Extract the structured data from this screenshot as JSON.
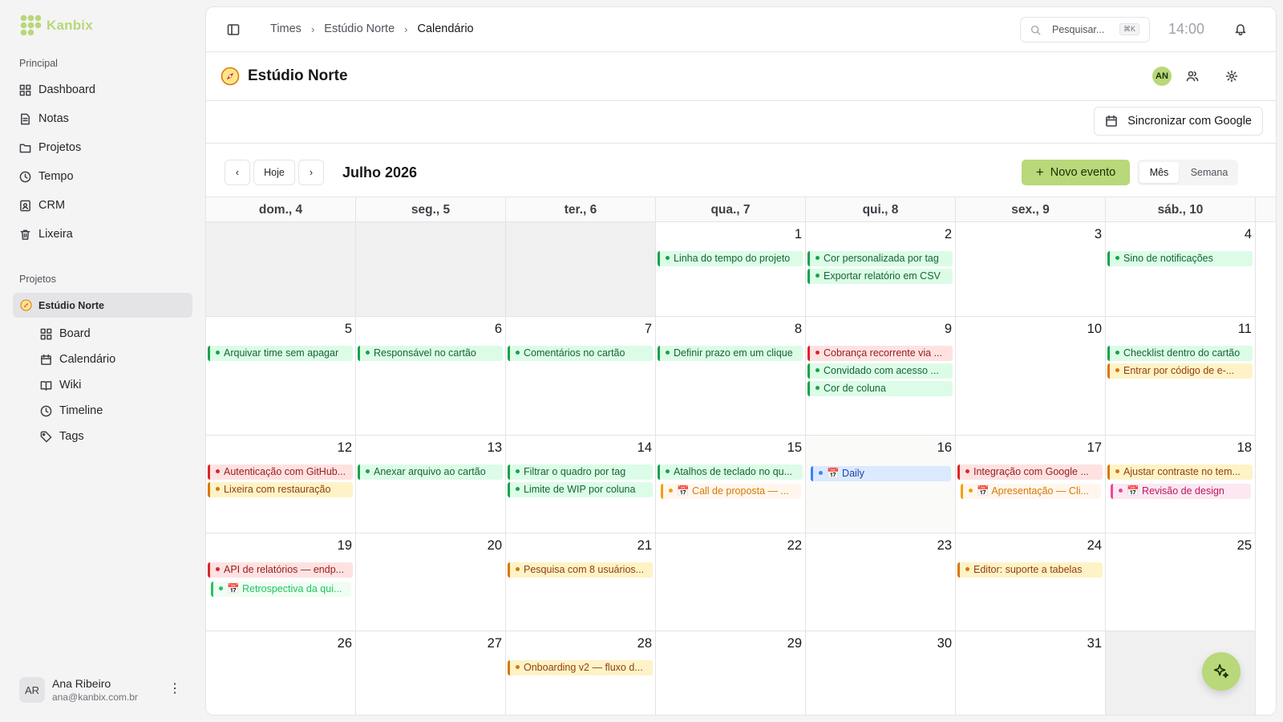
{
  "app": {
    "name": "Kanbix"
  },
  "sidebar": {
    "principal_label": "Principal",
    "items": [
      {
        "label": "Dashboard",
        "icon": "dashboard-icon"
      },
      {
        "label": "Notas",
        "icon": "notes-icon"
      },
      {
        "label": "Projetos",
        "icon": "folder-icon"
      },
      {
        "label": "Tempo",
        "icon": "clock-icon"
      },
      {
        "label": "CRM",
        "icon": "contact-icon"
      },
      {
        "label": "Lixeira",
        "icon": "trash-icon"
      }
    ],
    "projects_label": "Projetos",
    "project": {
      "name": "Estúdio Norte",
      "icon": "compass-icon"
    },
    "project_items": [
      {
        "label": "Board",
        "icon": "board-icon"
      },
      {
        "label": "Calendário",
        "icon": "calendar-icon"
      },
      {
        "label": "Wiki",
        "icon": "book-icon"
      },
      {
        "label": "Timeline",
        "icon": "clock-icon"
      },
      {
        "label": "Tags",
        "icon": "tag-icon"
      }
    ],
    "user": {
      "initials": "AR",
      "name": "Ana Ribeiro",
      "email": "ana@kanbix.com.br"
    }
  },
  "topbar": {
    "breadcrumb": [
      "Times",
      "Estúdio Norte",
      "Calendário"
    ],
    "search_placeholder": "Pesquisar...",
    "search_shortcut": "⌘K",
    "time": "14:00"
  },
  "project_header": {
    "title": "Estúdio Norte",
    "member_initials": "AN"
  },
  "sync_button": "Sincronizar com Google",
  "calendar": {
    "today_label": "Hoje",
    "month_label": "Julho 2026",
    "new_event_label": "Novo evento",
    "view_month": "Mês",
    "view_week": "Semana",
    "weekdays": [
      "dom., 4",
      "seg., 5",
      "ter., 6",
      "qua., 7",
      "qui., 8",
      "sex., 9",
      "sáb., 10"
    ],
    "weeks": [
      [
        {
          "day": "",
          "out": true,
          "events": []
        },
        {
          "day": "",
          "out": true,
          "events": []
        },
        {
          "day": "",
          "out": true,
          "events": []
        },
        {
          "day": "1",
          "events": [
            {
              "title": "Linha do tempo do projeto",
              "color": "green"
            }
          ]
        },
        {
          "day": "2",
          "events": [
            {
              "title": "Cor personalizada por tag",
              "color": "green"
            },
            {
              "title": "Exportar relatório em CSV",
              "color": "green"
            }
          ]
        },
        {
          "day": "3",
          "events": []
        },
        {
          "day": "4",
          "events": [
            {
              "title": "Sino de notificações",
              "color": "green"
            }
          ]
        }
      ],
      [
        {
          "day": "5",
          "events": [
            {
              "title": "Arquivar time sem apagar",
              "color": "green"
            }
          ]
        },
        {
          "day": "6",
          "events": [
            {
              "title": "Responsável no cartão",
              "color": "green"
            }
          ]
        },
        {
          "day": "7",
          "events": [
            {
              "title": "Comentários no cartão",
              "color": "green"
            }
          ]
        },
        {
          "day": "8",
          "events": [
            {
              "title": "Definir prazo em um clique",
              "color": "green"
            }
          ]
        },
        {
          "day": "9",
          "events": [
            {
              "title": "Cobrança recorrente via ...",
              "color": "red"
            },
            {
              "title": "Convidado com acesso ...",
              "color": "green"
            },
            {
              "title": "Cor de coluna",
              "color": "green"
            }
          ]
        },
        {
          "day": "10",
          "events": []
        },
        {
          "day": "11",
          "events": [
            {
              "title": "Checklist dentro do cartão",
              "color": "green"
            },
            {
              "title": "Entrar por código de e-...",
              "color": "orange"
            }
          ]
        }
      ],
      [
        {
          "day": "12",
          "events": [
            {
              "title": "Autenticação com GitHub...",
              "color": "red"
            },
            {
              "title": "Lixeira com restauração",
              "color": "orange"
            }
          ]
        },
        {
          "day": "13",
          "events": [
            {
              "title": "Anexar arquivo ao cartão",
              "color": "green"
            }
          ]
        },
        {
          "day": "14",
          "events": [
            {
              "title": "Filtrar o quadro por tag",
              "color": "green"
            },
            {
              "title": "Limite de WIP por coluna",
              "color": "green"
            }
          ]
        },
        {
          "day": "15",
          "events": [
            {
              "title": "Atalhos de teclado no qu...",
              "color": "green"
            },
            {
              "title": "📅 Call de proposta — ...",
              "color": "mtg-orange",
              "meeting": true
            }
          ]
        },
        {
          "day": "16",
          "today": true,
          "events": [
            {
              "title": "📅 Daily",
              "color": "mtg-blue",
              "meeting": true
            }
          ]
        },
        {
          "day": "17",
          "events": [
            {
              "title": "Integração com Google ...",
              "color": "red"
            },
            {
              "title": "📅 Apresentação — Cli...",
              "color": "mtg-orange",
              "meeting": true
            }
          ]
        },
        {
          "day": "18",
          "events": [
            {
              "title": "Ajustar contraste no tem...",
              "color": "orange"
            },
            {
              "title": "📅 Revisão de design",
              "color": "mtg-pink",
              "meeting": true
            }
          ]
        }
      ],
      [
        {
          "day": "19",
          "events": [
            {
              "title": "API de relatórios — endp...",
              "color": "red"
            },
            {
              "title": "📅 Retrospectiva da qui...",
              "color": "mtg-green",
              "meeting": true
            }
          ]
        },
        {
          "day": "20",
          "events": []
        },
        {
          "day": "21",
          "events": [
            {
              "title": "Pesquisa com 8 usuários...",
              "color": "orange"
            }
          ]
        },
        {
          "day": "22",
          "events": []
        },
        {
          "day": "23",
          "events": []
        },
        {
          "day": "24",
          "events": [
            {
              "title": "Editor: suporte a tabelas",
              "color": "orange"
            }
          ]
        },
        {
          "day": "25",
          "events": []
        }
      ],
      [
        {
          "day": "26",
          "events": []
        },
        {
          "day": "27",
          "events": []
        },
        {
          "day": "28",
          "events": [
            {
              "title": "Onboarding v2 — fluxo d...",
              "color": "orange"
            }
          ]
        },
        {
          "day": "29",
          "events": []
        },
        {
          "day": "30",
          "events": []
        },
        {
          "day": "31",
          "events": []
        },
        {
          "day": "",
          "out": true,
          "events": []
        }
      ]
    ]
  },
  "colors": {
    "accent": "#b8d879",
    "event_green": "#16a34a",
    "event_red": "#dc2626",
    "event_orange": "#d97706"
  }
}
